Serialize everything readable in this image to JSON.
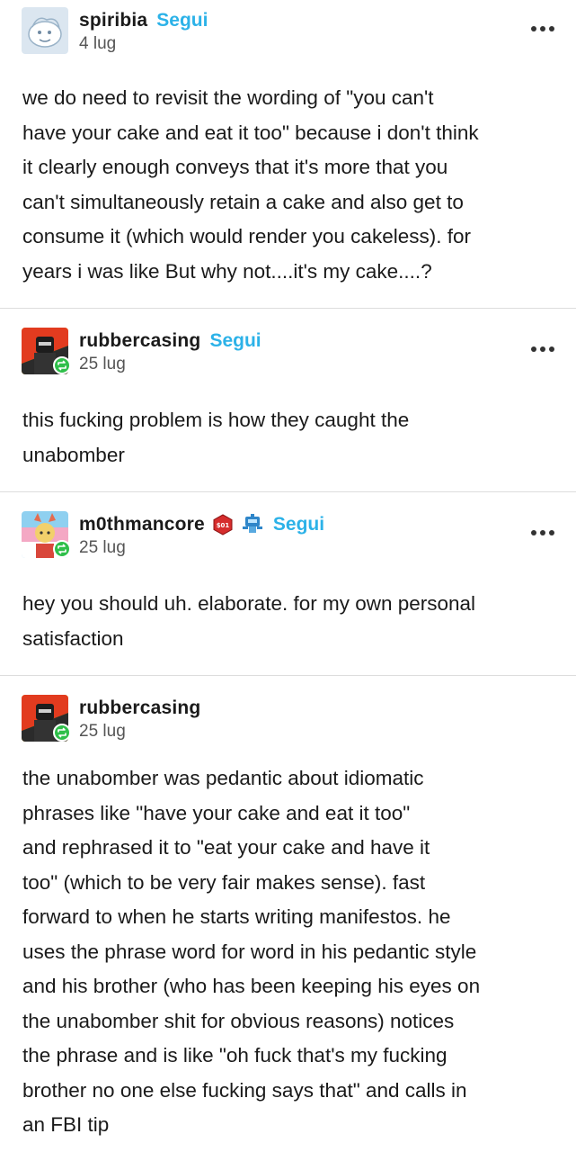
{
  "posts": [
    {
      "username": "spiribia",
      "follow_label": "Segui",
      "date": "4 lug",
      "lines": [
        "we do need to revisit the wording of \"you can't",
        "have your cake and eat it too\" because i don't think",
        "it clearly enough conveys that it's more that you",
        "can't simultaneously retain a cake and also get to",
        "consume it (which would render you cakeless). for",
        "years i was like But why not....it's my cake....?"
      ]
    },
    {
      "username": "rubbercasing",
      "follow_label": "Segui",
      "date": "25 lug",
      "lines": [
        "this fucking problem is how they caught the",
        "unabomber"
      ]
    },
    {
      "username": "m0thmancore",
      "follow_label": "Segui",
      "date": "25 lug",
      "badge_text": "$01",
      "lines": [
        "hey you should uh. elaborate. for my own personal",
        "satisfaction"
      ]
    },
    {
      "username": "rubbercasing",
      "date": "25 lug",
      "lines": [
        "the unabomber was pedantic about idiomatic",
        "phrases like \"have your cake and eat it too\"",
        "and rephrased it to \"eat your cake and have it",
        "too\" (which to be very fair makes sense). fast",
        "forward to when he starts writing manifestos. he",
        "uses the phrase word for word in his pedantic style",
        "and his brother (who has been keeping his eyes on",
        "the unabomber shit for obvious reasons) notices",
        "the phrase and is like \"oh fuck that's my fucking",
        "brother no one else fucking says that\" and calls in",
        "an FBI tip"
      ]
    }
  ],
  "colors": {
    "follow": "#2cb2e8",
    "reblog_badge": "#2fbf4a",
    "divider": "#dddddd",
    "text": "#1a1a1a"
  },
  "icons": {
    "more": "more-options-icon",
    "reblog": "reblog-icon",
    "badge_red": "hexagon-badge-icon",
    "badge_blue": "robot-badge-icon"
  }
}
